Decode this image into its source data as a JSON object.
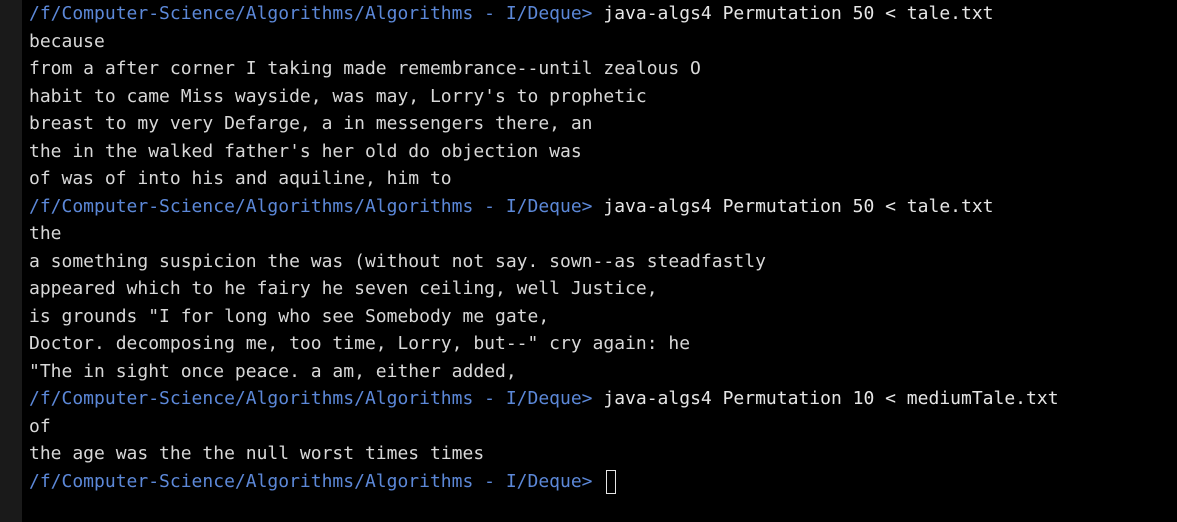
{
  "terminal": {
    "prompt": "/f/Computer-Science/Algorithms/Algorithms - I/Deque>",
    "runs": [
      {
        "command": "java-algs4 Permutation 50 < tale.txt",
        "output": [
          "because",
          "from a after corner I taking made remembrance--until zealous O",
          "habit to came Miss wayside, was may, Lorry's to prophetic",
          "breast to my very Defarge, a in messengers there, an",
          "the in the walked father's her old do objection was",
          "of was of into his and aquiline, him to"
        ]
      },
      {
        "command": "java-algs4 Permutation 50 < tale.txt",
        "output": [
          "the",
          "a something suspicion the was (without not say. sown--as steadfastly",
          "appeared which to he fairy he seven ceiling, well Justice,",
          "is grounds \"I for long who see Somebody me gate,",
          "Doctor. decomposing me, too time, Lorry, but--\" cry again: he",
          "\"The in sight once peace. a am, either added,"
        ]
      },
      {
        "command": "java-algs4 Permutation 10 < mediumTale.txt",
        "output": [
          "of",
          "the age was the the null worst times times"
        ]
      }
    ],
    "current_input": ""
  }
}
